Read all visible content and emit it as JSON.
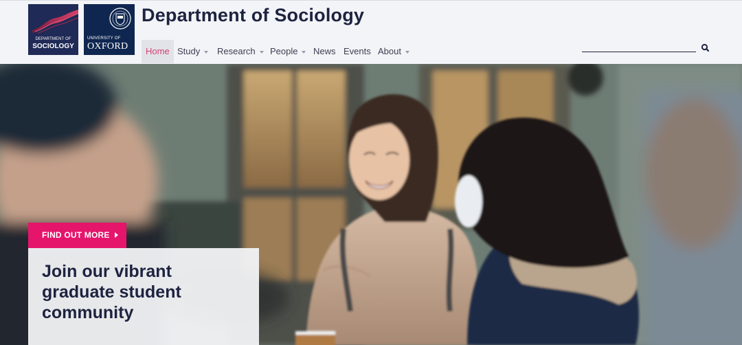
{
  "logos": {
    "department": {
      "line1": "DEPARTMENT OF",
      "line2": "SOCIOLOGY"
    },
    "university": {
      "line1": "UNIVERSITY OF",
      "line2": "OXFORD"
    }
  },
  "site_title": "Department of Sociology",
  "nav": {
    "items": [
      {
        "label": "Home",
        "active": true,
        "dropdown": false
      },
      {
        "label": "Study",
        "active": false,
        "dropdown": true
      },
      {
        "label": "Research",
        "active": false,
        "dropdown": true
      },
      {
        "label": "People",
        "active": false,
        "dropdown": true
      },
      {
        "label": "News",
        "active": false,
        "dropdown": false
      },
      {
        "label": "Events",
        "active": false,
        "dropdown": false
      },
      {
        "label": "About",
        "active": false,
        "dropdown": true
      }
    ]
  },
  "search": {
    "value": "",
    "placeholder": "",
    "icon": "search-icon"
  },
  "hero": {
    "cta_label": "FIND OUT MORE",
    "headline": "Join our vibrant graduate student community"
  },
  "colors": {
    "accent": "#e5156c",
    "nav_active": "#d23f73",
    "navy": "#1d2340",
    "header_bg": "#f3f4f7"
  }
}
